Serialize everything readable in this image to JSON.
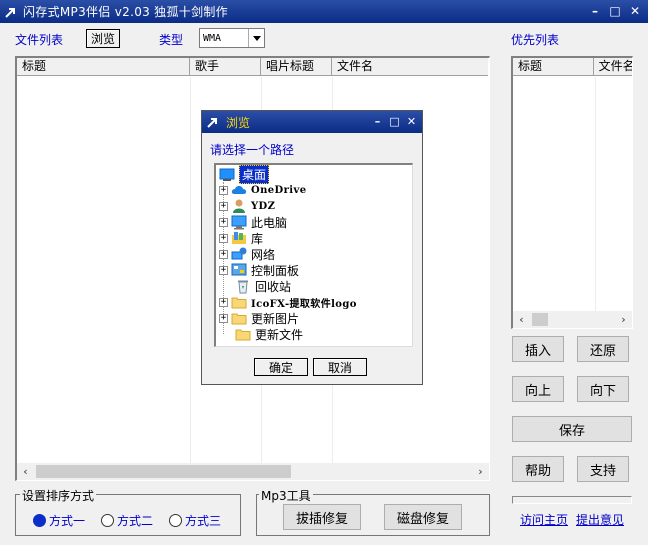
{
  "window": {
    "title": "闪存式MP3伴侣 v2.03 独孤十剑制作"
  },
  "toolbar": {
    "file_list_label": "文件列表",
    "browse_label": "浏览",
    "type_label": "类型",
    "type_value": "WMA",
    "priority_list_label": "优先列表"
  },
  "file_list": {
    "columns": [
      "标题",
      "歌手",
      "唱片标题",
      "文件名"
    ]
  },
  "priority_list": {
    "columns": [
      "标题",
      "文件名"
    ]
  },
  "side_buttons": {
    "insert": "插入",
    "restore": "还原",
    "up": "向上",
    "down": "向下",
    "save": "保存",
    "help": "帮助",
    "support": "支持"
  },
  "sort_group": {
    "title": "设置排序方式",
    "options": [
      "方式一",
      "方式二",
      "方式三"
    ],
    "selected": "方式一"
  },
  "mp3_tools": {
    "title": "Mp3工具",
    "hotplug_repair": "拔插修复",
    "disk_repair": "磁盘修复"
  },
  "links": {
    "homepage": "访问主页",
    "feedback": "提出意见"
  },
  "dialog": {
    "title": "浏览",
    "prompt": "请选择一个路径",
    "tree": [
      {
        "label": "桌面",
        "icon": "desktop-icon",
        "expander": "",
        "selected": true
      },
      {
        "label": "OneDrive",
        "icon": "cloud-icon",
        "expander": "+"
      },
      {
        "label": "YDZ",
        "icon": "user-icon",
        "expander": "+"
      },
      {
        "label": "此电脑",
        "icon": "computer-icon",
        "expander": "+"
      },
      {
        "label": "库",
        "icon": "library-icon",
        "expander": "+"
      },
      {
        "label": "网络",
        "icon": "network-icon",
        "expander": "+"
      },
      {
        "label": "控制面板",
        "icon": "control-panel-icon",
        "expander": "+"
      },
      {
        "label": "回收站",
        "icon": "recycle-bin-icon",
        "expander": ""
      },
      {
        "label": "IcoFX-提取软件logo",
        "icon": "folder-icon",
        "expander": "+"
      },
      {
        "label": "更新图片",
        "icon": "folder-icon",
        "expander": "+"
      },
      {
        "label": "更新文件",
        "icon": "folder-icon",
        "expander": ""
      }
    ],
    "ok": "确定",
    "cancel": "取消"
  }
}
